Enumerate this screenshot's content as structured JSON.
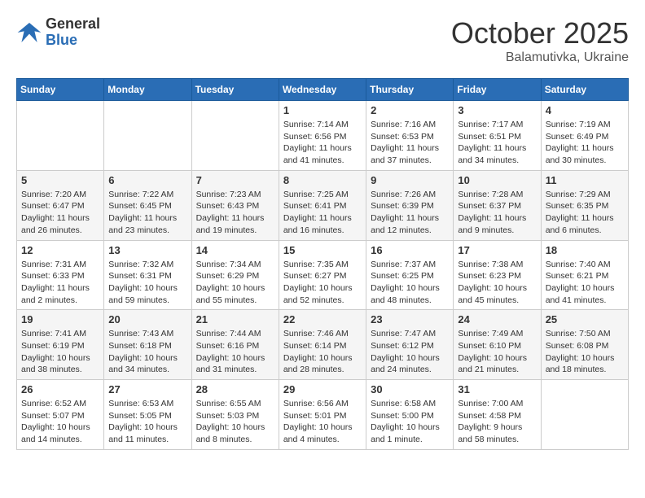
{
  "header": {
    "logo_text_general": "General",
    "logo_text_blue": "Blue",
    "month": "October 2025",
    "location": "Balamutivka, Ukraine"
  },
  "weekdays": [
    "Sunday",
    "Monday",
    "Tuesday",
    "Wednesday",
    "Thursday",
    "Friday",
    "Saturday"
  ],
  "weeks": [
    [
      {
        "day": "",
        "info": ""
      },
      {
        "day": "",
        "info": ""
      },
      {
        "day": "",
        "info": ""
      },
      {
        "day": "1",
        "info": "Sunrise: 7:14 AM\nSunset: 6:56 PM\nDaylight: 11 hours\nand 41 minutes."
      },
      {
        "day": "2",
        "info": "Sunrise: 7:16 AM\nSunset: 6:53 PM\nDaylight: 11 hours\nand 37 minutes."
      },
      {
        "day": "3",
        "info": "Sunrise: 7:17 AM\nSunset: 6:51 PM\nDaylight: 11 hours\nand 34 minutes."
      },
      {
        "day": "4",
        "info": "Sunrise: 7:19 AM\nSunset: 6:49 PM\nDaylight: 11 hours\nand 30 minutes."
      }
    ],
    [
      {
        "day": "5",
        "info": "Sunrise: 7:20 AM\nSunset: 6:47 PM\nDaylight: 11 hours\nand 26 minutes."
      },
      {
        "day": "6",
        "info": "Sunrise: 7:22 AM\nSunset: 6:45 PM\nDaylight: 11 hours\nand 23 minutes."
      },
      {
        "day": "7",
        "info": "Sunrise: 7:23 AM\nSunset: 6:43 PM\nDaylight: 11 hours\nand 19 minutes."
      },
      {
        "day": "8",
        "info": "Sunrise: 7:25 AM\nSunset: 6:41 PM\nDaylight: 11 hours\nand 16 minutes."
      },
      {
        "day": "9",
        "info": "Sunrise: 7:26 AM\nSunset: 6:39 PM\nDaylight: 11 hours\nand 12 minutes."
      },
      {
        "day": "10",
        "info": "Sunrise: 7:28 AM\nSunset: 6:37 PM\nDaylight: 11 hours\nand 9 minutes."
      },
      {
        "day": "11",
        "info": "Sunrise: 7:29 AM\nSunset: 6:35 PM\nDaylight: 11 hours\nand 6 minutes."
      }
    ],
    [
      {
        "day": "12",
        "info": "Sunrise: 7:31 AM\nSunset: 6:33 PM\nDaylight: 11 hours\nand 2 minutes."
      },
      {
        "day": "13",
        "info": "Sunrise: 7:32 AM\nSunset: 6:31 PM\nDaylight: 10 hours\nand 59 minutes."
      },
      {
        "day": "14",
        "info": "Sunrise: 7:34 AM\nSunset: 6:29 PM\nDaylight: 10 hours\nand 55 minutes."
      },
      {
        "day": "15",
        "info": "Sunrise: 7:35 AM\nSunset: 6:27 PM\nDaylight: 10 hours\nand 52 minutes."
      },
      {
        "day": "16",
        "info": "Sunrise: 7:37 AM\nSunset: 6:25 PM\nDaylight: 10 hours\nand 48 minutes."
      },
      {
        "day": "17",
        "info": "Sunrise: 7:38 AM\nSunset: 6:23 PM\nDaylight: 10 hours\nand 45 minutes."
      },
      {
        "day": "18",
        "info": "Sunrise: 7:40 AM\nSunset: 6:21 PM\nDaylight: 10 hours\nand 41 minutes."
      }
    ],
    [
      {
        "day": "19",
        "info": "Sunrise: 7:41 AM\nSunset: 6:19 PM\nDaylight: 10 hours\nand 38 minutes."
      },
      {
        "day": "20",
        "info": "Sunrise: 7:43 AM\nSunset: 6:18 PM\nDaylight: 10 hours\nand 34 minutes."
      },
      {
        "day": "21",
        "info": "Sunrise: 7:44 AM\nSunset: 6:16 PM\nDaylight: 10 hours\nand 31 minutes."
      },
      {
        "day": "22",
        "info": "Sunrise: 7:46 AM\nSunset: 6:14 PM\nDaylight: 10 hours\nand 28 minutes."
      },
      {
        "day": "23",
        "info": "Sunrise: 7:47 AM\nSunset: 6:12 PM\nDaylight: 10 hours\nand 24 minutes."
      },
      {
        "day": "24",
        "info": "Sunrise: 7:49 AM\nSunset: 6:10 PM\nDaylight: 10 hours\nand 21 minutes."
      },
      {
        "day": "25",
        "info": "Sunrise: 7:50 AM\nSunset: 6:08 PM\nDaylight: 10 hours\nand 18 minutes."
      }
    ],
    [
      {
        "day": "26",
        "info": "Sunrise: 6:52 AM\nSunset: 5:07 PM\nDaylight: 10 hours\nand 14 minutes."
      },
      {
        "day": "27",
        "info": "Sunrise: 6:53 AM\nSunset: 5:05 PM\nDaylight: 10 hours\nand 11 minutes."
      },
      {
        "day": "28",
        "info": "Sunrise: 6:55 AM\nSunset: 5:03 PM\nDaylight: 10 hours\nand 8 minutes."
      },
      {
        "day": "29",
        "info": "Sunrise: 6:56 AM\nSunset: 5:01 PM\nDaylight: 10 hours\nand 4 minutes."
      },
      {
        "day": "30",
        "info": "Sunrise: 6:58 AM\nSunset: 5:00 PM\nDaylight: 10 hours\nand 1 minute."
      },
      {
        "day": "31",
        "info": "Sunrise: 7:00 AM\nSunset: 4:58 PM\nDaylight: 9 hours\nand 58 minutes."
      },
      {
        "day": "",
        "info": ""
      }
    ]
  ]
}
